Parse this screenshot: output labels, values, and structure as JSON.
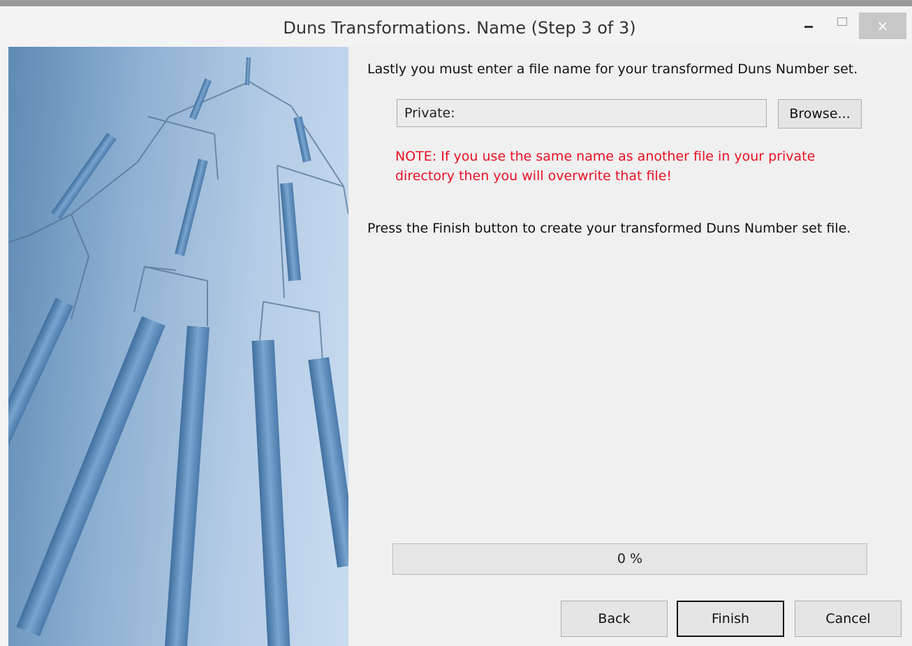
{
  "window": {
    "title": "Duns Transformations.  Name (Step 3 of 3)",
    "controls": {
      "minimize": "minimize-icon",
      "maximize": "maximize-icon",
      "close": "×"
    }
  },
  "image": {
    "name": "network-tree-illustration"
  },
  "main": {
    "intro": "Lastly you must enter a file name for your transformed Duns Number set.",
    "file_field_value": "Private:",
    "browse_label": "Browse...",
    "note": "NOTE: If you use the same name as another file in your private directory then you will overwrite that file!",
    "press_text": "Press the Finish button to create your transformed Duns Number set file.",
    "progress": {
      "value": 0,
      "label": "0 %"
    }
  },
  "buttons": {
    "back": "Back",
    "finish": "Finish",
    "cancel": "Cancel"
  },
  "colors": {
    "note": "#e81123",
    "image_blue": "#5e8ab4"
  }
}
